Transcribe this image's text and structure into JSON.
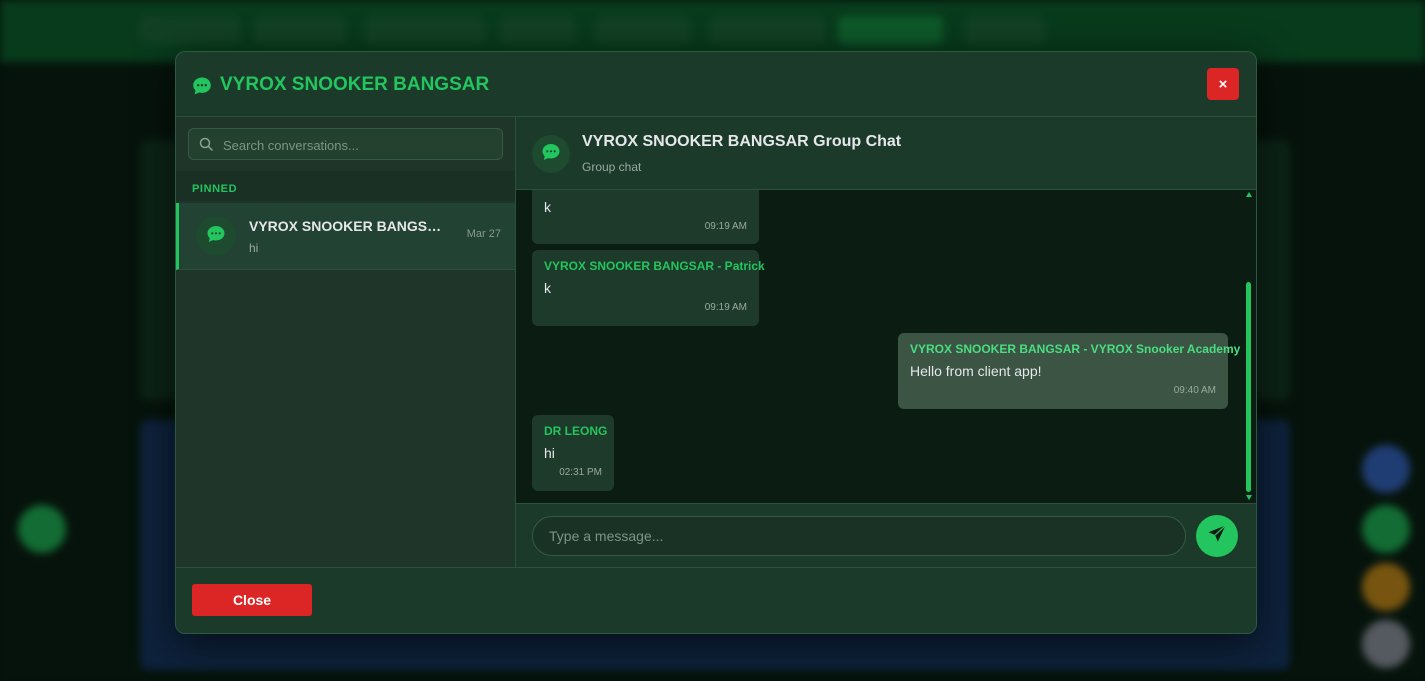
{
  "modal": {
    "title": "VYROX SNOOKER BANGSAR",
    "close_icon_glyph": "×",
    "title_icon": "chat-bubble-icon"
  },
  "sidebar": {
    "search_placeholder": "Search conversations...",
    "section_label": "PINNED",
    "conversations": [
      {
        "name": "VYROX SNOOKER BANGSAR ...",
        "preview": "hi",
        "date": "Mar 27",
        "icon": "chat-bubble-icon"
      }
    ]
  },
  "chat": {
    "title": "VYROX SNOOKER BANGSAR Group Chat",
    "subtitle": "Group chat",
    "messages": [
      {
        "direction": "in",
        "sender": "",
        "text": "k",
        "time": "09:19 AM"
      },
      {
        "direction": "in",
        "sender": "VYROX SNOOKER BANGSAR - Patrick",
        "text": "k",
        "time": "09:19 AM"
      },
      {
        "direction": "out",
        "sender": "VYROX SNOOKER BANGSAR - VYROX Snooker Academy",
        "text": "Hello from client app!",
        "time": "09:40 AM"
      },
      {
        "direction": "in",
        "sender": "DR LEONG",
        "text": "hi",
        "time": "02:31 PM"
      }
    ],
    "input_placeholder": "Type a message..."
  },
  "footer": {
    "close_label": "Close"
  },
  "colors": {
    "accent": "#22c55e",
    "danger": "#dc2626",
    "modal_bg": "#1c3a2a",
    "messages_bg": "#0b1c13"
  }
}
